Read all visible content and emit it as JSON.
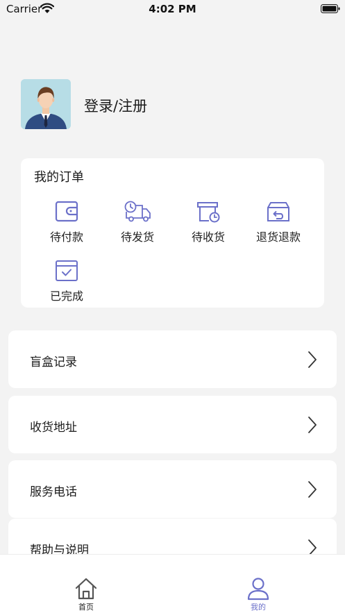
{
  "status_bar": {
    "carrier": "Carrier",
    "time": "4:02 PM"
  },
  "profile": {
    "login_label": "登录/注册"
  },
  "orders": {
    "title": "我的订单",
    "items": [
      {
        "label": "待付款",
        "icon": "wallet-icon"
      },
      {
        "label": "待发货",
        "icon": "delivery-truck-icon"
      },
      {
        "label": "待收货",
        "icon": "pending-receipt-icon"
      },
      {
        "label": "退货退款",
        "icon": "return-box-icon"
      },
      {
        "label": "已完成",
        "icon": "completed-calendar-icon"
      }
    ]
  },
  "menu": [
    {
      "label": "盲盒记录"
    },
    {
      "label": "收货地址"
    },
    {
      "label": "服务电话"
    },
    {
      "label": "帮助与说明"
    }
  ],
  "tabs": [
    {
      "label": "首页",
      "icon": "home-icon",
      "active": false
    },
    {
      "label": "我的",
      "icon": "profile-icon",
      "active": true
    }
  ],
  "colors": {
    "accent": "#6b70c9",
    "background": "#f3f3f3",
    "card": "#ffffff",
    "inactive_tab": "#555555"
  }
}
